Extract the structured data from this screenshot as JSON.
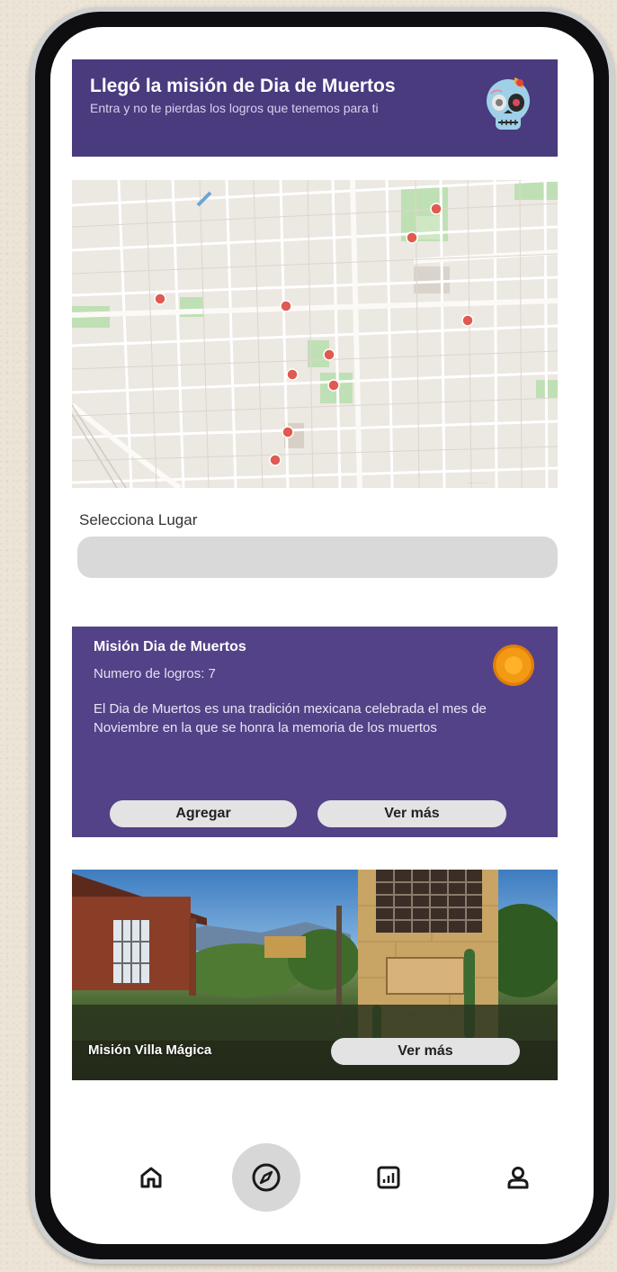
{
  "banner": {
    "title": "Llegó la misión de Dia de Muertos",
    "subtitle": "Entra y no te pierdas los logros que tenemos para ti",
    "icon": "sugar-skull-icon"
  },
  "map": {
    "pin_count": 11,
    "pin_color": "#e05a52"
  },
  "place_select": {
    "label": "Selecciona Lugar",
    "value": ""
  },
  "mission_card": {
    "title": "Misión Dia de Muertos",
    "achievements": "Numero de logros: 7",
    "description": "El Dia de Muertos es una tradición mexicana celebrada el mes de Noviembre en la que se honra la memoria de los muertos",
    "icon": "marigold-icon",
    "add_label": "Agregar",
    "more_label": "Ver más"
  },
  "villa_card": {
    "title": "Misión Villa Mágica",
    "more_label": "Ver más"
  },
  "nav": {
    "items": [
      "home-icon",
      "compass-icon",
      "stats-icon",
      "profile-icon"
    ],
    "active": "compass-icon"
  },
  "colors": {
    "brand_purple": "#4a3a7e",
    "card_purple": "#534287",
    "button_gray": "#e3e3e3"
  }
}
